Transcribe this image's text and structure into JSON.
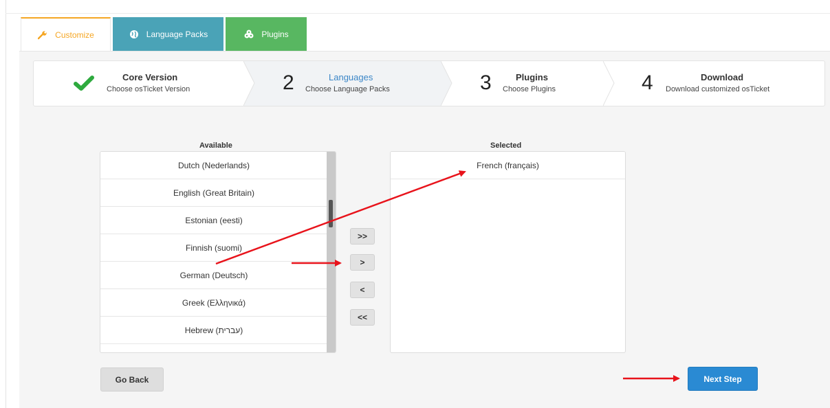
{
  "tabs": [
    {
      "label": "Customize",
      "icon": "wrench-icon",
      "active": true,
      "color": "#f5a623"
    },
    {
      "label": "Language Packs",
      "icon": "globe-icon",
      "color": "#4aa3b7"
    },
    {
      "label": "Plugins",
      "icon": "puzzle-icon",
      "color": "#58b761"
    }
  ],
  "steps": [
    {
      "num": "",
      "title": "Core Version",
      "subtitle": "Choose osTicket Version",
      "status": "complete",
      "icon": "check-icon",
      "icon_color": "#2eaa3e"
    },
    {
      "num": "2",
      "title": "Languages",
      "subtitle": "Choose Language Packs",
      "status": "active",
      "title_color": "#3b86c7"
    },
    {
      "num": "3",
      "title": "Plugins",
      "subtitle": "Choose Plugins"
    },
    {
      "num": "4",
      "title": "Download",
      "subtitle": "Download customized osTicket"
    }
  ],
  "available": {
    "label": "Available",
    "items": [
      "Dutch (Nederlands)",
      "English (Great Britain)",
      "Estonian (eesti)",
      "Finnish (suomi)",
      "German (Deutsch)",
      "Greek (Ελληνικά)",
      "Hebrew (עברית)"
    ]
  },
  "selected": {
    "label": "Selected",
    "items": [
      "French (français)"
    ]
  },
  "move_buttons": {
    "add_all": ">>",
    "add": ">",
    "remove": "<",
    "remove_all": "<<"
  },
  "buttons": {
    "back": "Go Back",
    "next": "Next Step"
  },
  "colors": {
    "accent": "#2a8ad3",
    "annotation_arrow": "#e8131b"
  }
}
